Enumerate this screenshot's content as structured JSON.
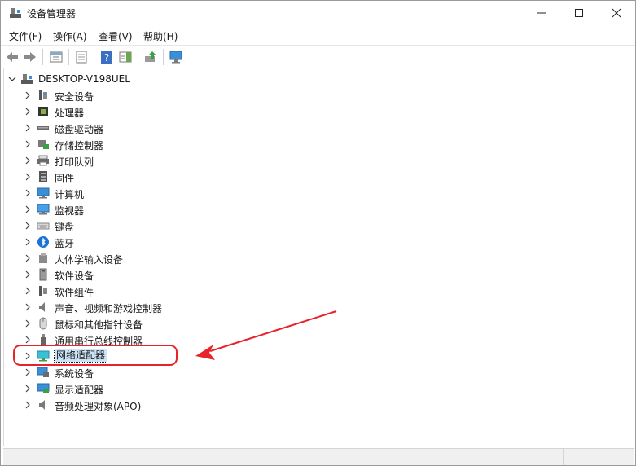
{
  "window": {
    "title": "设备管理器"
  },
  "menu": [
    {
      "label": "文件(F)"
    },
    {
      "label": "操作(A)"
    },
    {
      "label": "查看(V)"
    },
    {
      "label": "帮助(H)"
    }
  ],
  "tree": {
    "root": "DESKTOP-V198UEL",
    "items": [
      {
        "label": "安全设备",
        "icon": "security-device-icon"
      },
      {
        "label": "处理器",
        "icon": "processor-icon"
      },
      {
        "label": "磁盘驱动器",
        "icon": "disk-drive-icon"
      },
      {
        "label": "存储控制器",
        "icon": "storage-controller-icon"
      },
      {
        "label": "打印队列",
        "icon": "printer-icon"
      },
      {
        "label": "固件",
        "icon": "firmware-icon"
      },
      {
        "label": "计算机",
        "icon": "computer-icon"
      },
      {
        "label": "监视器",
        "icon": "monitor-icon"
      },
      {
        "label": "键盘",
        "icon": "keyboard-icon"
      },
      {
        "label": "蓝牙",
        "icon": "bluetooth-icon"
      },
      {
        "label": "人体学输入设备",
        "icon": "hid-icon"
      },
      {
        "label": "软件设备",
        "icon": "software-device-icon"
      },
      {
        "label": "软件组件",
        "icon": "software-component-icon"
      },
      {
        "label": "声音、视频和游戏控制器",
        "icon": "speaker-icon"
      },
      {
        "label": "鼠标和其他指针设备",
        "icon": "mouse-icon"
      },
      {
        "label": "通用串行总线控制器",
        "icon": "usb-icon"
      },
      {
        "label": "网络适配器",
        "icon": "network-adapter-icon",
        "selected": true
      },
      {
        "label": "系统设备",
        "icon": "system-device-icon"
      },
      {
        "label": "显示适配器",
        "icon": "display-adapter-icon"
      },
      {
        "label": "音频处理对象(APO)",
        "icon": "audio-processing-icon"
      }
    ]
  },
  "annotation_color": "#e8222a",
  "selection_color": "#cce4f7"
}
